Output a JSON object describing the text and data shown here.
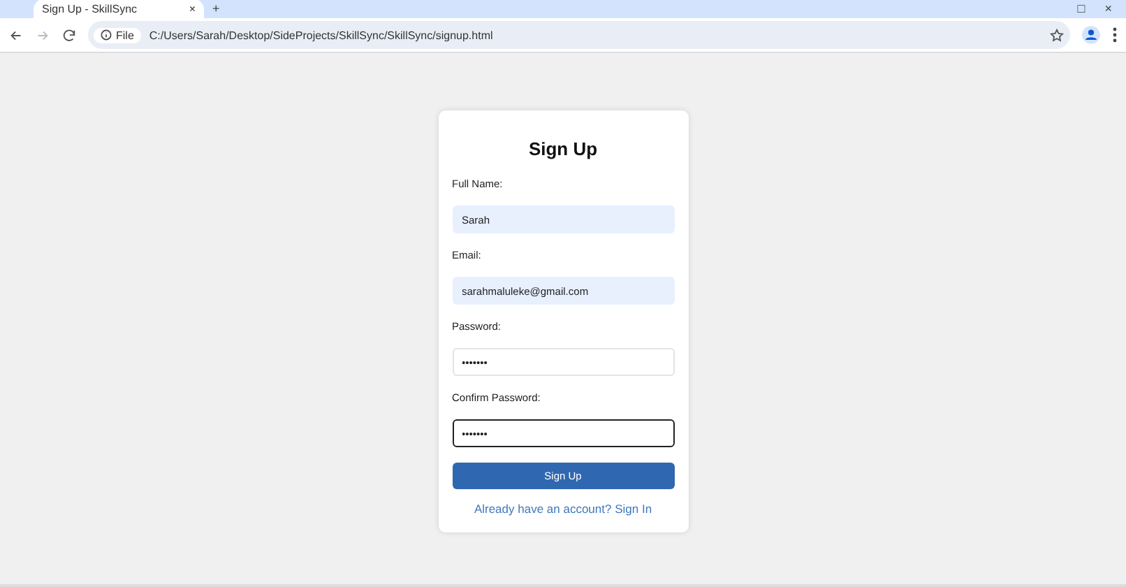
{
  "tab": {
    "title": "Sign Up - SkillSync",
    "close": "×",
    "new_tab": "+"
  },
  "window_controls": {
    "restore": "□",
    "close": "×"
  },
  "toolbar": {
    "badge": "File",
    "url": "C:/Users/Sarah/Desktop/SideProjects/SkillSync/SkillSync/signup.html"
  },
  "form": {
    "title": "Sign Up",
    "fields": [
      {
        "label": "Full Name:",
        "value": "Sarah",
        "autofilled": true,
        "focused": false
      },
      {
        "label": "Email:",
        "value": "sarahmaluleke@gmail.com",
        "autofilled": true,
        "focused": false
      },
      {
        "label": "Password:",
        "value": "•••••••",
        "autofilled": false,
        "focused": false
      },
      {
        "label": "Confirm Password:",
        "value": "•••••••",
        "autofilled": false,
        "focused": true
      }
    ],
    "button": "Sign Up",
    "link": "Already have an account? Sign In"
  }
}
